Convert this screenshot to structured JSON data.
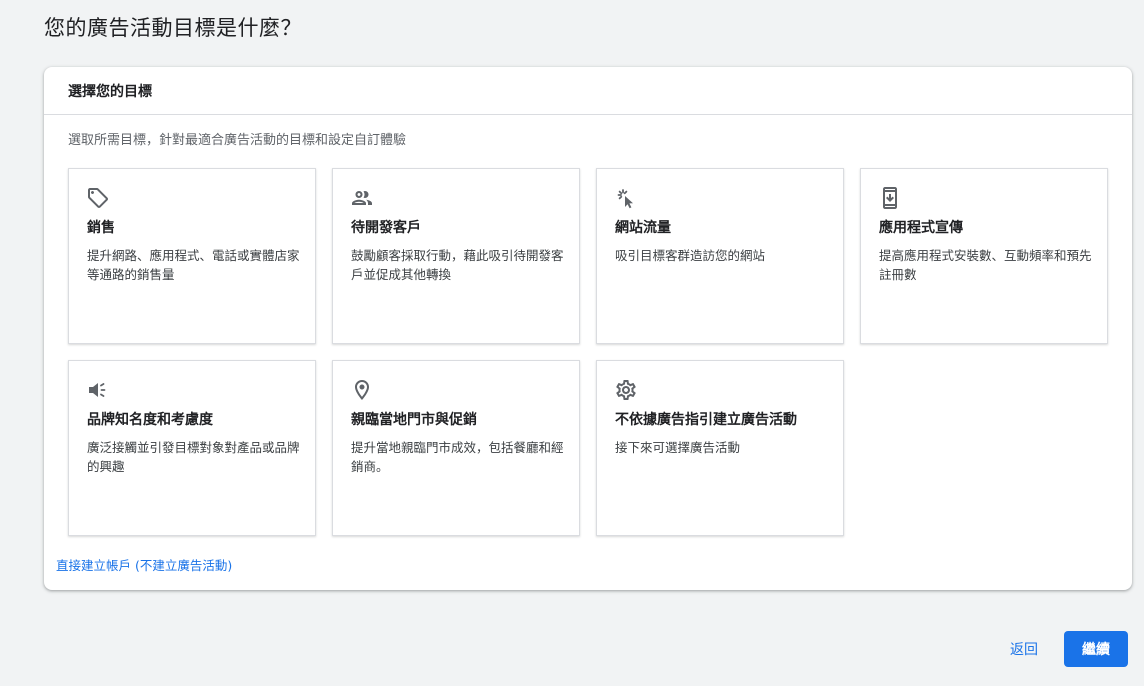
{
  "page": {
    "title": "您的廣告活動目標是什麼？"
  },
  "panel": {
    "header": "選擇您的目標",
    "description": "選取所需目標，針對最適合廣告活動的目標和設定自訂體驗",
    "direct_link": "直接建立帳戶 (不建立廣告活動)"
  },
  "cards": [
    {
      "icon": "tag-icon",
      "title": "銷售",
      "description": "提升網路、應用程式、電話或實體店家等通路的銷售量"
    },
    {
      "icon": "people-icon",
      "title": "待開發客戶",
      "description": "鼓勵顧客採取行動，藉此吸引待開發客戶並促成其他轉換"
    },
    {
      "icon": "cursor-click-icon",
      "title": "網站流量",
      "description": "吸引目標客群造訪您的網站"
    },
    {
      "icon": "phone-download-icon",
      "title": "應用程式宣傳",
      "description": "提高應用程式安裝數、互動頻率和預先註冊數"
    },
    {
      "icon": "megaphone-icon",
      "title": "品牌知名度和考慮度",
      "description": "廣泛接觸並引發目標對象對產品或品牌的興趣"
    },
    {
      "icon": "location-pin-icon",
      "title": "親臨當地門市與促銷",
      "description": "提升當地親臨門市成效，包括餐廳和經銷商。"
    },
    {
      "icon": "gear-icon",
      "title": "不依據廣告指引建立廣告活動",
      "description": "接下來可選擇廣告活動"
    }
  ],
  "footer": {
    "back_label": "返回",
    "continue_label": "繼續"
  },
  "colors": {
    "accent": "#1a73e8",
    "background": "#f1f3f4",
    "icon": "#5f6368"
  }
}
